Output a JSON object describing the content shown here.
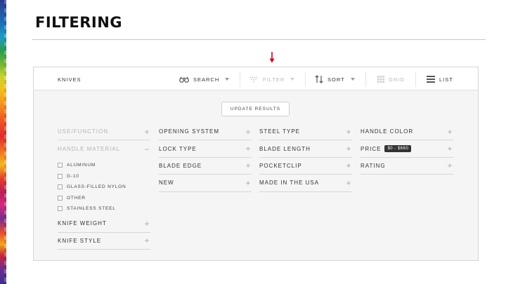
{
  "slide": {
    "title": "FILTERING"
  },
  "colors": {
    "accent_arrow": "#d0021b",
    "badge_bg": "#333333"
  },
  "toolbar": {
    "title": "KNIVES",
    "items": [
      {
        "label": "SEARCH",
        "icon": "binoculars-icon",
        "active": true
      },
      {
        "label": "FILTER",
        "icon": "filter-icon",
        "active": false
      },
      {
        "label": "SORT",
        "icon": "sort-arrows-icon",
        "active": true
      },
      {
        "label": "GRID",
        "icon": "grid-icon",
        "active": false
      },
      {
        "label": "LIST",
        "icon": "list-icon",
        "active": true
      }
    ]
  },
  "update_button": {
    "label": "UPDATE RESULTS"
  },
  "facets": {
    "col1": [
      {
        "label": "USE/FUNCTION",
        "sign": "+",
        "dim": true
      },
      {
        "label": "HANDLE MATERIAL",
        "sign": "−",
        "dim": true,
        "options": [
          "ALUMINUM",
          "G-10",
          "GLASS-FILLED NYLON",
          "OTHER",
          "STAINLESS STEEL"
        ]
      },
      {
        "label": "KNIFE WEIGHT",
        "sign": "+"
      },
      {
        "label": "KNIFE STYLE",
        "sign": "+"
      }
    ],
    "col2": [
      {
        "label": "OPENING SYSTEM",
        "sign": "+"
      },
      {
        "label": "LOCK TYPE",
        "sign": "+"
      },
      {
        "label": "BLADE EDGE",
        "sign": "+"
      },
      {
        "label": "NEW",
        "sign": "+"
      }
    ],
    "col3": [
      {
        "label": "STEEL TYPE",
        "sign": "+"
      },
      {
        "label": "BLADE LENGTH",
        "sign": "+"
      },
      {
        "label": "POCKETCLIP",
        "sign": "+"
      },
      {
        "label": "MADE IN THE USA",
        "sign": "+"
      }
    ],
    "col4": [
      {
        "label": "HANDLE COLOR",
        "sign": "+"
      },
      {
        "label": "PRICE",
        "sign": "+",
        "badge": "$0 - $660"
      },
      {
        "label": "RATING",
        "sign": "+"
      }
    ]
  }
}
